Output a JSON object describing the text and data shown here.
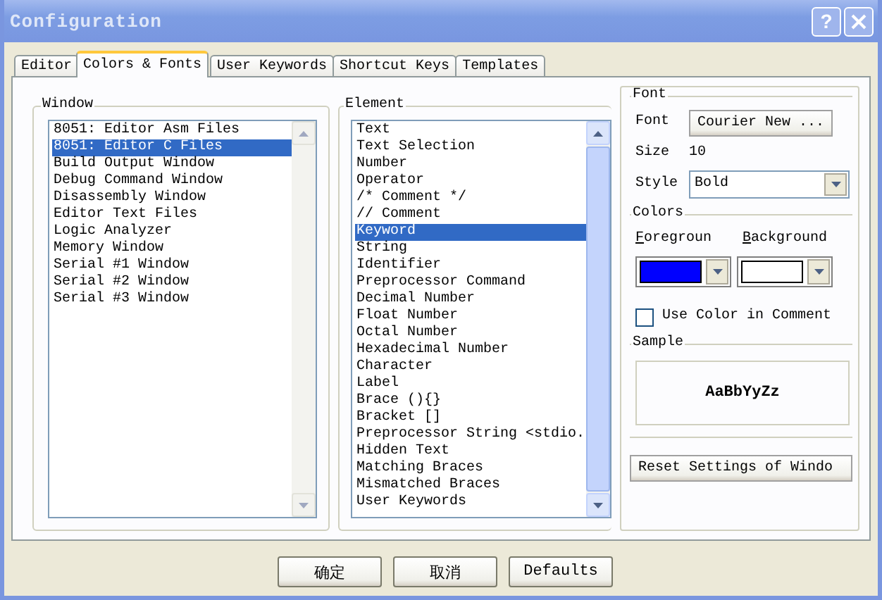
{
  "window": {
    "title": "Configuration",
    "help_button": "?"
  },
  "tabs": [
    {
      "label": "Editor",
      "selected": false
    },
    {
      "label": "Colors & Fonts",
      "selected": true
    },
    {
      "label": "User Keywords",
      "selected": false
    },
    {
      "label": "Shortcut Keys",
      "selected": false
    },
    {
      "label": "Templates",
      "selected": false
    }
  ],
  "window_list": {
    "label": "Window",
    "items": [
      {
        "label": "8051: Editor Asm Files",
        "selected": false
      },
      {
        "label": "8051: Editor C Files",
        "selected": true
      },
      {
        "label": "Build Output Window",
        "selected": false
      },
      {
        "label": "Debug Command Window",
        "selected": false
      },
      {
        "label": "Disassembly Window",
        "selected": false
      },
      {
        "label": "Editor Text Files",
        "selected": false
      },
      {
        "label": "Logic Analyzer",
        "selected": false
      },
      {
        "label": "Memory Window",
        "selected": false
      },
      {
        "label": "Serial #1 Window",
        "selected": false
      },
      {
        "label": "Serial #2 Window",
        "selected": false
      },
      {
        "label": "Serial #3 Window",
        "selected": false
      }
    ]
  },
  "element_list": {
    "label": "Element",
    "items": [
      {
        "label": "Text",
        "selected": false
      },
      {
        "label": "Text Selection",
        "selected": false
      },
      {
        "label": "Number",
        "selected": false
      },
      {
        "label": "Operator",
        "selected": false
      },
      {
        "label": "/* Comment */",
        "selected": false
      },
      {
        "label": "// Comment",
        "selected": false
      },
      {
        "label": "Keyword",
        "selected": true
      },
      {
        "label": "String",
        "selected": false
      },
      {
        "label": "Identifier",
        "selected": false
      },
      {
        "label": "Preprocessor Command",
        "selected": false
      },
      {
        "label": "Decimal Number",
        "selected": false
      },
      {
        "label": "Float Number",
        "selected": false
      },
      {
        "label": "Octal Number",
        "selected": false
      },
      {
        "label": "Hexadecimal Number",
        "selected": false
      },
      {
        "label": "Character",
        "selected": false
      },
      {
        "label": "Label",
        "selected": false
      },
      {
        "label": "Brace (){}",
        "selected": false
      },
      {
        "label": "Bracket []",
        "selected": false
      },
      {
        "label": "Preprocessor String <stdio.",
        "selected": false
      },
      {
        "label": "Hidden Text",
        "selected": false
      },
      {
        "label": "Matching Braces",
        "selected": false
      },
      {
        "label": "Mismatched Braces",
        "selected": false
      },
      {
        "label": "User Keywords",
        "selected": false
      }
    ]
  },
  "font": {
    "label": "Font",
    "font_label": "Font",
    "font_button": "Courier New ...",
    "size_label": "Size",
    "size_value": "10",
    "style_label": "Style",
    "style_value": "Bold"
  },
  "colors": {
    "label": "Colors",
    "swatches": [
      {
        "label": "Foregroun",
        "color": "#0000ff"
      },
      {
        "label": "Background",
        "color": "#ffffff"
      }
    ],
    "use_color_in_comments": {
      "label": "Use Color in Comment",
      "checked": false
    }
  },
  "sample": {
    "label": "Sample",
    "text": "AaBbYyZz"
  },
  "reset_button": "Reset Settings of Windo",
  "buttons": [
    "确定",
    "取消",
    "Defaults"
  ]
}
